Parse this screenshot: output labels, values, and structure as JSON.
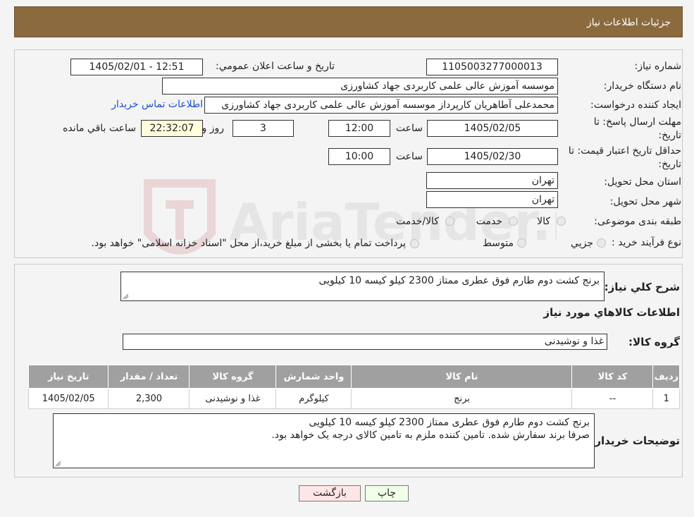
{
  "header": {
    "title": "جزئیات اطلاعات نیاز"
  },
  "watermark": {
    "text": "AriaTender.neT"
  },
  "form": {
    "need_number": {
      "label": "شماره نیاز:",
      "value": "1105003277000013"
    },
    "announce": {
      "label": "تاریخ و ساعت اعلان عمومي:",
      "value": "1405/02/01 - 12:51"
    },
    "buyer": {
      "label": "نام دستگاه خریدار:",
      "value": "موسسه آموزش عالی علمی کاربردی جهاد کشاورزی"
    },
    "creator": {
      "label": "ایجاد کننده درخواست:",
      "value": "محمدعلی آطاهریان کارپرداز موسسه آموزش عالی علمی کاربردی جهاد کشاورزی",
      "contact_link": "اطلاعات تماس خریدار"
    },
    "deadline": {
      "label_line1": "مهلت ارسال پاسخ: تا",
      "label_line2": "تاریخ:",
      "date": "1405/02/05",
      "time_label": "ساعت",
      "time": "12:00",
      "days": "3",
      "days_label": "روز و",
      "remaining": "22:32:07",
      "remaining_label": "ساعت باقي مانده"
    },
    "validity": {
      "label_line1": "حداقل تاریخ اعتبار قیمت: تا",
      "label_line2": "تاریخ:",
      "date": "1405/02/30",
      "time_label": "ساعت",
      "time": "10:00"
    },
    "province": {
      "label": "استان محل تحویل:",
      "value": "تهران"
    },
    "city": {
      "label": "شهر محل تحویل:",
      "value": "تهران"
    },
    "category": {
      "label": "طبقه بندی موضوعی:",
      "options": [
        "کالا",
        "خدمت",
        "کالا/خدمت"
      ]
    },
    "process": {
      "label": "نوع فرآیند خرید :",
      "options": [
        "جزیي",
        "متوسط"
      ],
      "note": "پرداخت تمام یا بخشی از مبلغ خرید،از محل \"اسناد خزانه اسلامی\" خواهد بود."
    }
  },
  "section2": {
    "summary_label": "شرح کلي نیاز:",
    "summary": "برنج کشت دوم طارم فوق عطری ممتاز 2300 کیلو کیسه 10 کیلویی",
    "goods_title": "اطلاعات کالاهاي مورد نیاز",
    "group_label": "گروه کالا:",
    "group_value": "غذا و نوشیدنی",
    "table": {
      "headers": [
        "ردیف",
        "کد کالا",
        "نام کالا",
        "واحد شمارش",
        "گروه کالا",
        "تعداد / مقدار",
        "تاریخ نیاز"
      ],
      "rows": [
        [
          "1",
          "--",
          "برنج",
          "کیلوگرم",
          "غذا و نوشیدنی",
          "2,300",
          "1405/02/05"
        ]
      ]
    },
    "notes_label": "توضیحات خریدار:",
    "notes_line1": "برنج کشت دوم طارم فوق عطری ممتاز 2300 کیلو کیسه 10 کیلویی",
    "notes_line2": "صرفا برند سفارش شده. تامین کننده ملزم به تامین کالای درجه یک خواهد بود."
  },
  "buttons": {
    "print": "چاپ",
    "back": "بازگشت"
  },
  "colors": {
    "header": "#8b6a3e",
    "link": "#1a4fd6",
    "print_btn": "#f2ffe8",
    "back_btn": "#ffe6e6"
  }
}
